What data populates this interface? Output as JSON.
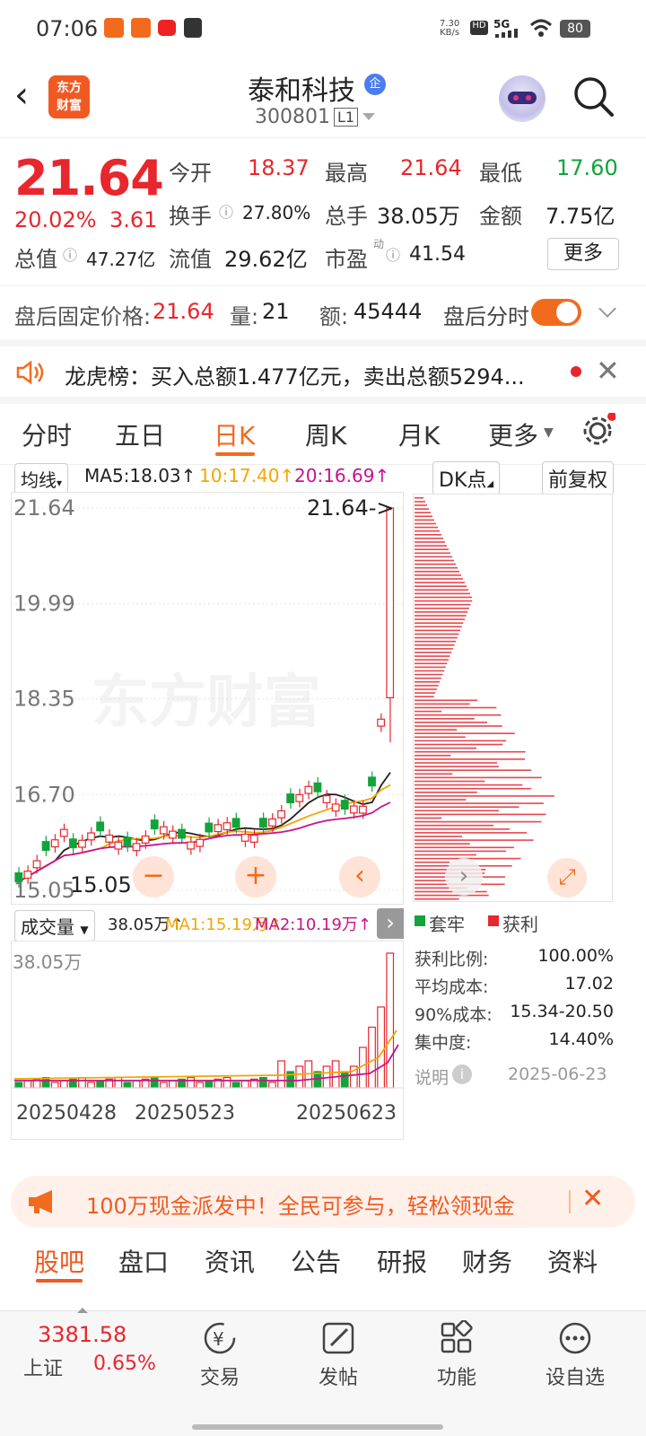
{
  "status": {
    "time": "07:06",
    "net_speed_top": "7.30",
    "net_speed_bottom": "KB/s",
    "signal": "5G",
    "battery": "80"
  },
  "header": {
    "logo_line1": "东方",
    "logo_line2": "财富",
    "title": "泰和科技",
    "badge": "企",
    "code": "300801",
    "level": "L1"
  },
  "quote": {
    "price": "21.64",
    "change_pct": "20.02%",
    "change": "3.61",
    "open_label": "今开",
    "open": "18.37",
    "high_label": "最高",
    "high": "21.64",
    "low_label": "最低",
    "low": "17.60",
    "turnover_label": "换手",
    "turnover": "27.80%",
    "volume_label": "总手",
    "volume": "38.05万",
    "amount_label": "金额",
    "amount": "7.75亿",
    "mktcap_label": "总值",
    "mktcap": "47.27亿",
    "float_label": "流值",
    "float": "29.62亿",
    "pe_label": "市盈",
    "pe_sup": "动",
    "pe": "41.54",
    "more": "更多"
  },
  "afterhours": {
    "label": "盘后固定价格:",
    "price": "21.64",
    "vol_label": "量:",
    "vol": "21",
    "amt_label": "额:",
    "amt": "45444",
    "toggle_label": "盘后分时"
  },
  "notice": {
    "text": "龙虎榜：买入总额1.477亿元，卖出总额5294..."
  },
  "tabs": [
    "分时",
    "五日",
    "日K",
    "周K",
    "月K",
    "更多"
  ],
  "chart_controls": {
    "ma_select": "均线",
    "ma5": "MA5:18.03↑",
    "ma10": "10:17.40↑",
    "ma20": "20:16.69↑",
    "dk": "DK点",
    "fq": "前复权"
  },
  "chart_data": {
    "type": "candlestick",
    "y_ticks": [
      "21.64",
      "19.99",
      "18.35",
      "16.70",
      "15.05"
    ],
    "ylim": [
      15.05,
      21.64
    ],
    "high_marker": "21.64->",
    "low_marker": "15.05",
    "x_ticks": [
      "20250428",
      "20250523",
      "20250623"
    ],
    "last_candle": {
      "open": 18.37,
      "high": 21.64,
      "low": 17.6,
      "close": 21.64
    },
    "colors": {
      "up": "#e8262d",
      "down": "#12a33a",
      "ma5": "#222222",
      "ma10": "#f2a600",
      "ma20": "#c8138c"
    }
  },
  "volume_panel": {
    "select": "成交量",
    "vol": "38.05万↑",
    "ma1": "MA1:15.19万↑",
    "ma2": "MA2:10.19万↑",
    "max_label": "38.05万"
  },
  "chips": {
    "legend_trapped": "套牢",
    "legend_profit": "获利",
    "rows": [
      {
        "label": "获利比例:",
        "value": "100.00%"
      },
      {
        "label": "平均成本:",
        "value": "17.02"
      },
      {
        "label": "90%成本:",
        "value": "15.34-20.50"
      },
      {
        "label": "集中度:",
        "value": "14.40%"
      }
    ],
    "note_label": "说明",
    "date": "2025-06-23"
  },
  "banner": {
    "text": "100万现金派发中！全民可参与，轻松领现金"
  },
  "bottom_tabs": [
    "股吧",
    "盘口",
    "资讯",
    "公告",
    "研报",
    "财务",
    "资料"
  ],
  "navbar": {
    "index_value": "3381.58",
    "index_name": "上证",
    "index_change": "0.65%",
    "items": [
      "交易",
      "发帖",
      "功能",
      "设自选"
    ]
  }
}
